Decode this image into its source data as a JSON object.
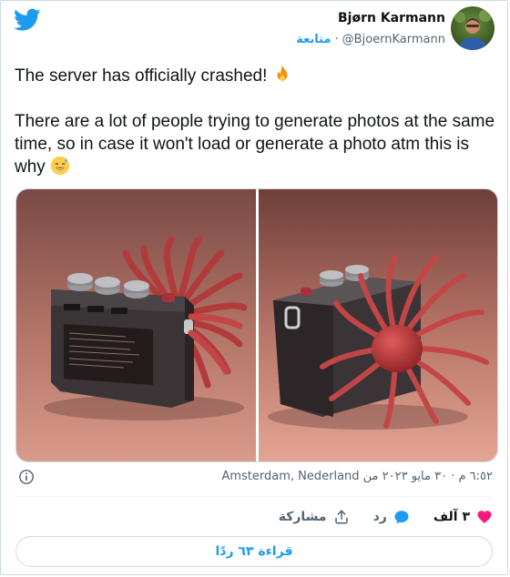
{
  "author": {
    "name": "Bjørn Karmann",
    "handle": "@BjoernKarmann",
    "follow_label": "متابعة",
    "separator": "·"
  },
  "tweet": {
    "line1": "The server has officially crashed!",
    "line2": "There are a lot of people trying to generate photos at the same time, so in case it won't load or generate a photo atm this is why"
  },
  "meta": {
    "timestamp": "٦:٥٢ م · ٣٠ مايو ٢٠٢٣ من Amsterdam, Nederland"
  },
  "actions": {
    "likes": "٣ آلف",
    "reply_label": "رد",
    "share_label": "مشاركة"
  },
  "read_replies_label": "قراءة ٦٣ ردًا",
  "colors": {
    "accent": "#1d9bf0",
    "like": "#f91880",
    "text": "#0f1419",
    "muted": "#536471"
  },
  "icons": [
    "twitter-bird-icon",
    "info-icon",
    "heart-icon",
    "reply-icon",
    "share-icon"
  ]
}
